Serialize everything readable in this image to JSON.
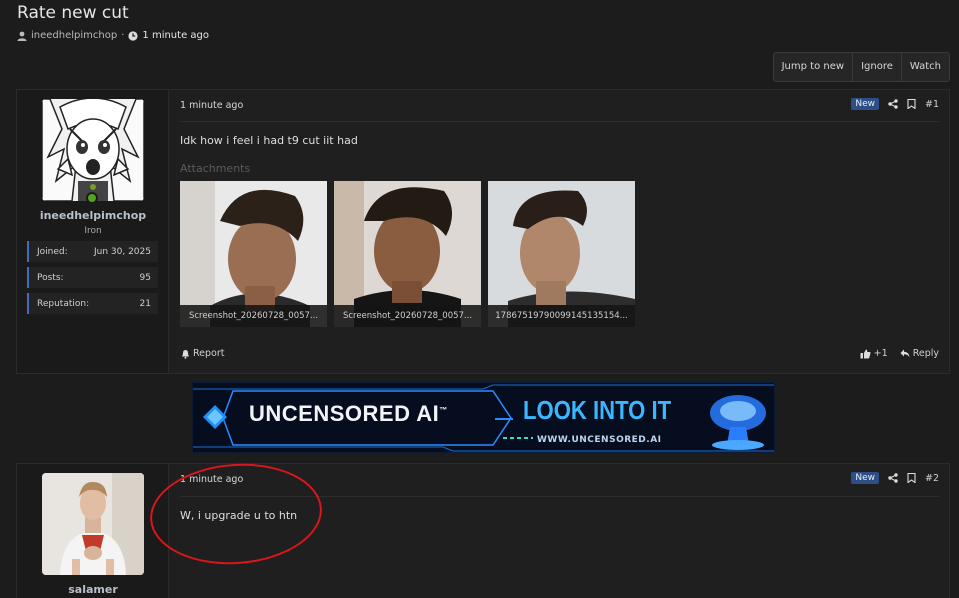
{
  "thread": {
    "title": "Rate new cut",
    "author": "ineedhelpimchop",
    "separator": "·",
    "time": "1 minute ago"
  },
  "thread_buttons": {
    "jump_to_new": "Jump to new",
    "ignore": "Ignore",
    "watch": "Watch"
  },
  "posts": [
    {
      "username": "ineedhelpimchop",
      "user_title": "Iron",
      "stats": [
        {
          "label": "Joined:",
          "value": "Jun 30, 2025"
        },
        {
          "label": "Posts:",
          "value": "95"
        },
        {
          "label": "Reputation:",
          "value": "21"
        }
      ],
      "time": "1 minute ago",
      "badge": "New",
      "number": "#1",
      "text": "Idk how i feel i had t9 cut iit had",
      "attachments_label": "Attachments",
      "attachments": [
        {
          "caption": "Screenshot_20260728_0057..."
        },
        {
          "caption": "Screenshot_20260728_0057..."
        },
        {
          "caption": "17867519790099145135154..."
        }
      ],
      "report_label": "Report",
      "reaction_count": "+1",
      "reply_label": "Reply"
    },
    {
      "username": "salamer",
      "time": "1 minute ago",
      "badge": "New",
      "number": "#2",
      "text": "W, i upgrade u to htn"
    }
  ],
  "ad": {
    "brand": "UNCENSORED AI",
    "trademark": "™",
    "cta": "LOOK INTO IT",
    "url": "WWW.UNCENSORED.AI"
  },
  "colors": {
    "accent": "#3f6fb5",
    "badge_new": "#2d4f86",
    "online": "#56a11d",
    "annotation": "#d8171b"
  }
}
